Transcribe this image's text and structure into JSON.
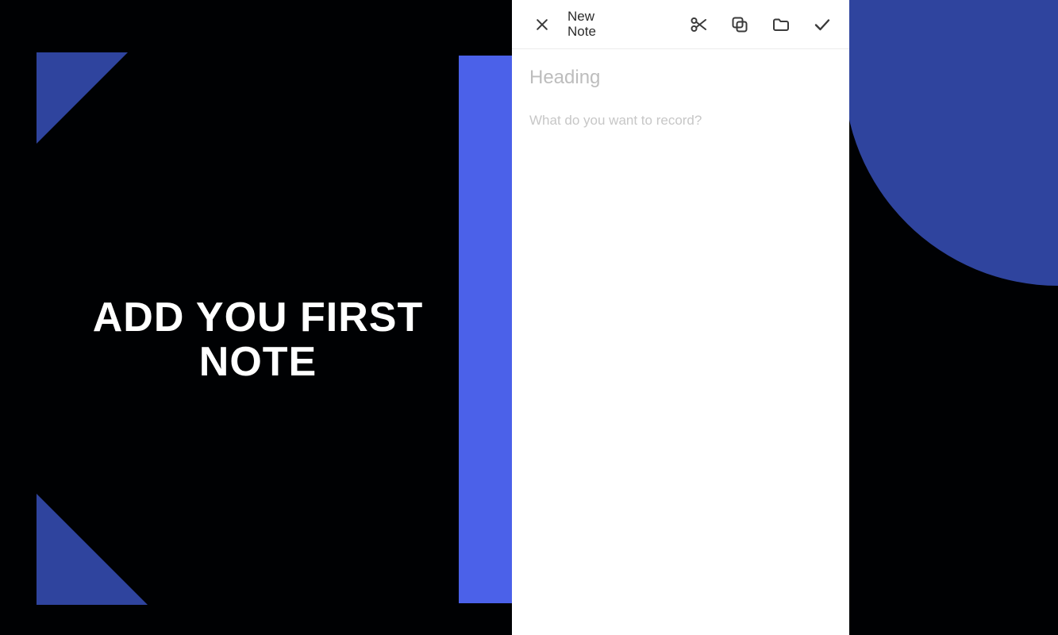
{
  "promo": {
    "headline": "ADD YOU FIRST NOTE"
  },
  "app": {
    "toolbar": {
      "title": "New Note"
    },
    "editor": {
      "heading_placeholder": "Heading",
      "body_placeholder": "What do you want to record?"
    }
  }
}
